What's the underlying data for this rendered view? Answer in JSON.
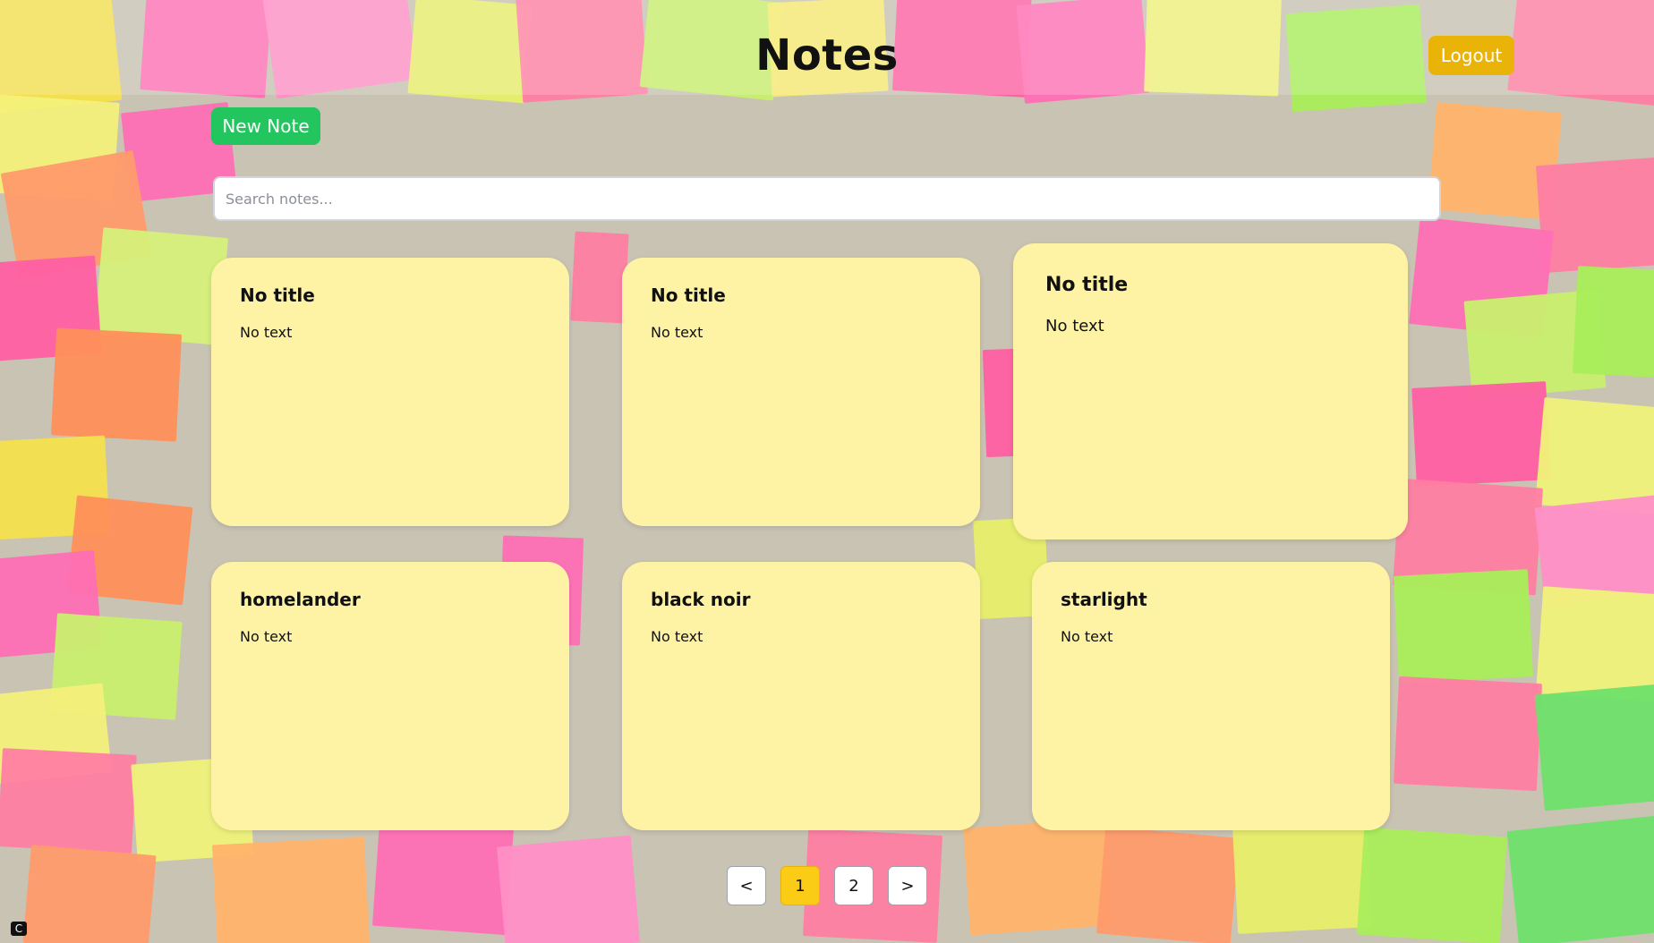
{
  "app": {
    "title": "Notes",
    "logout_label": "Logout",
    "new_note_label": "New Note"
  },
  "search": {
    "placeholder": "Search notes...",
    "value": ""
  },
  "notes": [
    {
      "title": "No title",
      "text": "No text"
    },
    {
      "title": "No title",
      "text": "No text"
    },
    {
      "title": "No title",
      "text": "No text"
    },
    {
      "title": "homelander",
      "text": "No text"
    },
    {
      "title": "black noir",
      "text": "No text"
    },
    {
      "title": "starlight",
      "text": "No text"
    }
  ],
  "pagination": {
    "prev_label": "<",
    "pages": [
      "1",
      "2"
    ],
    "current_page": "1",
    "next_label": ">"
  },
  "colors": {
    "logout": "#eab308",
    "new_note": "#22c55e",
    "card": "#fef3a4",
    "active_page": "#facc15"
  },
  "icons": {
    "corner": "browser-extension-icon"
  }
}
